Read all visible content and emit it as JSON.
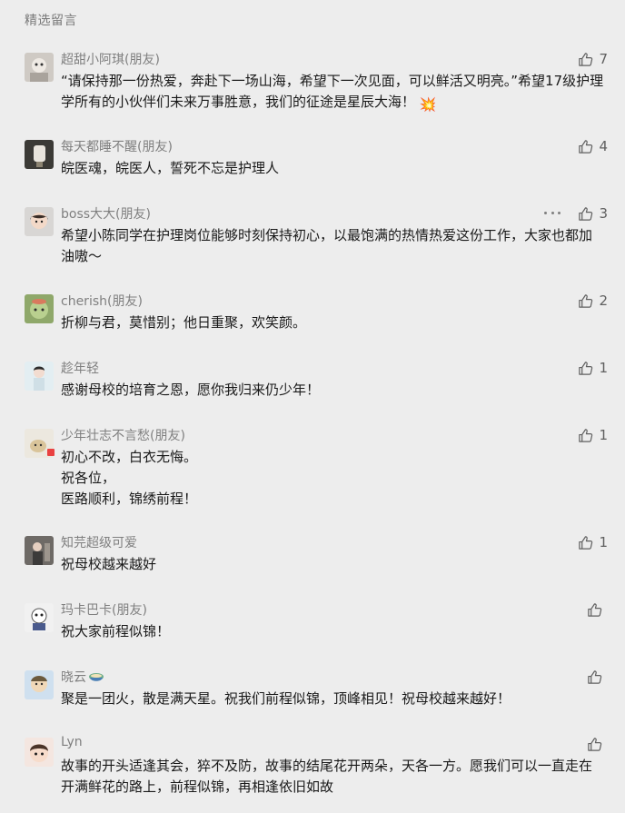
{
  "section_title": "精选留言",
  "comments": [
    {
      "nickname": "超甜小阿琪(朋友)",
      "text": "“请保持那一份热爱，奔赴下一场山海，希望下一次见面，可以鲜活又明亮。”希望17级护理学所有的小伙伴们未来万事胜意，我们的征途是星辰大海！",
      "likes": "7",
      "emoji": "💥"
    },
    {
      "nickname": "每天都睡不醒(朋友)",
      "text": "皖医魂，皖医人，誓死不忘是护理人",
      "likes": "4"
    },
    {
      "nickname": "boss大大(朋友)",
      "text": "希望小陈同学在护理岗位能够时刻保持初心，以最饱满的热情热爱这份工作，大家也都加油嗷～",
      "likes": "3"
    },
    {
      "nickname": "cherish(朋友)",
      "text": "折柳与君，莫惜别；他日重聚，欢笑颜。",
      "likes": "2"
    },
    {
      "nickname": "趁年轻",
      "text": "感谢母校的培育之恩，愿你我归来仍少年！",
      "likes": "1"
    },
    {
      "nickname": "少年壮志不言愁(朋友)",
      "text": "初心不改，白衣无悔。\n祝各位，\n医路顺利，锦绣前程！",
      "likes": "1"
    },
    {
      "nickname": "知芫超级可爱",
      "text": "祝母校越来越好",
      "likes": "1"
    },
    {
      "nickname": "玛卡巴卡(朋友)",
      "text": "祝大家前程似锦！",
      "likes": ""
    },
    {
      "nickname": "晓云",
      "text": "聚是一团火，散是满天星。祝我们前程似锦，顶峰相见！祝母校越来越好！",
      "likes": ""
    },
    {
      "nickname": "Lyn",
      "text": "故事的开头适逢其会，猝不及防，故事的结尾花开两朵，天各一方。愿我们可以一直走在开满鲜花的路上，前程似锦，再相逢依旧如故",
      "likes": ""
    }
  ],
  "colors": {
    "background": "#ededed",
    "nickname": "#7f7f7f",
    "text": "#191919",
    "icon": "#606060"
  },
  "icons": {
    "like": "thumbs-up-icon",
    "more": "more-dots-icon"
  }
}
